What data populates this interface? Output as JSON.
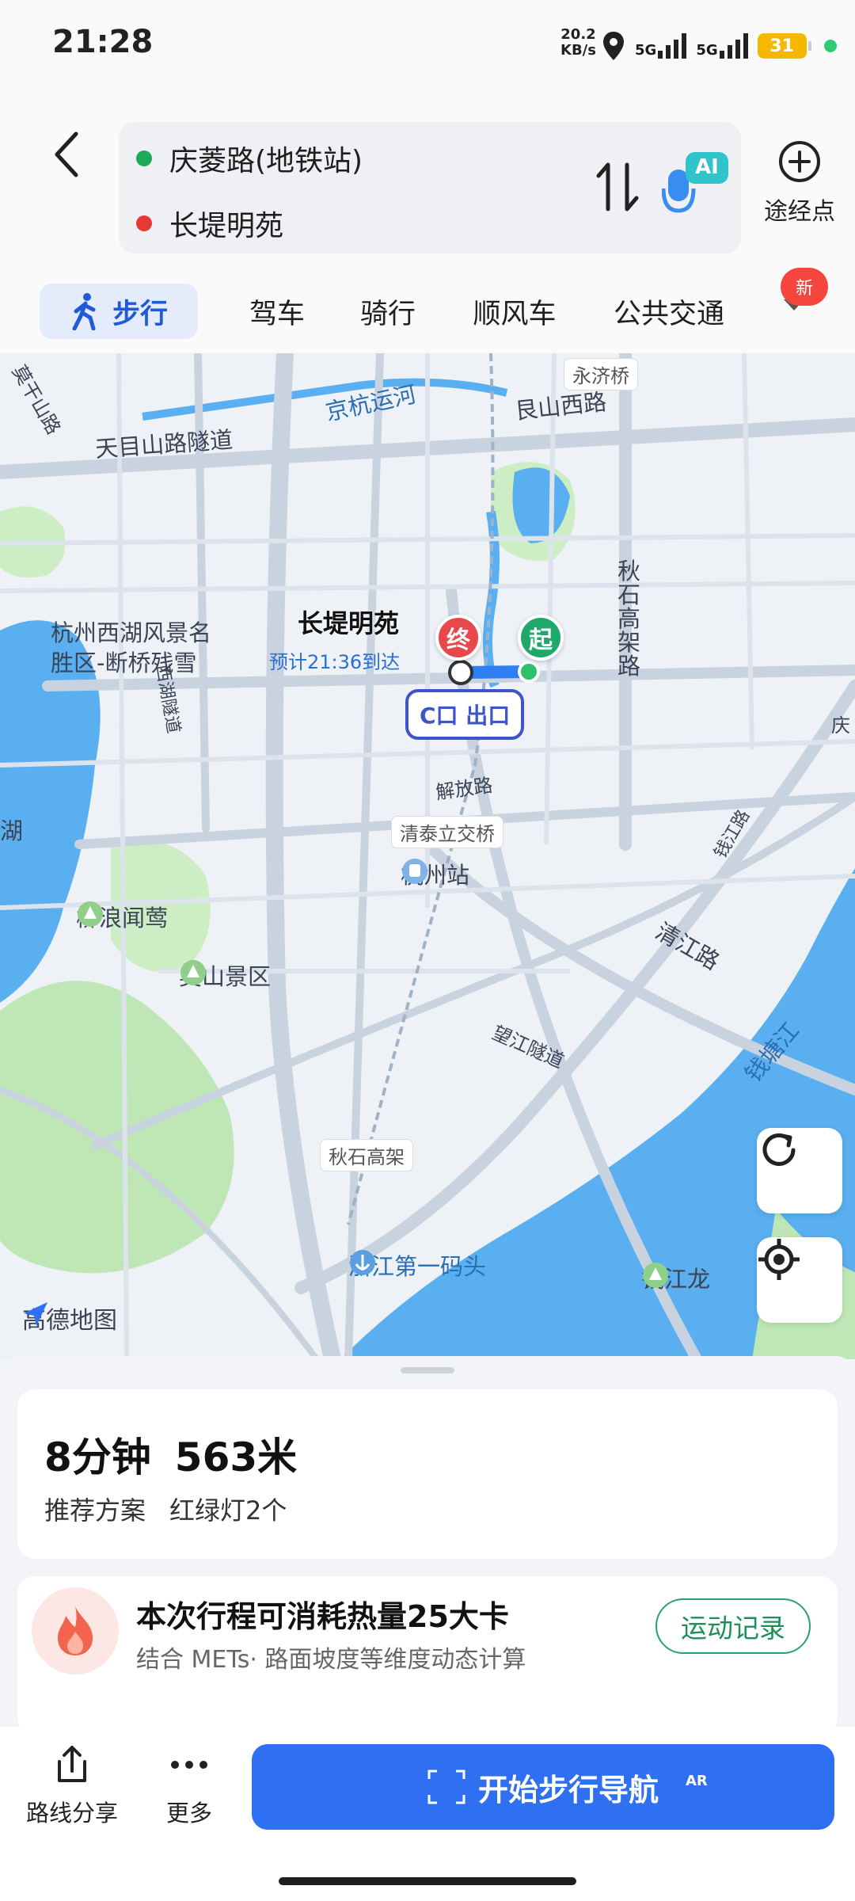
{
  "status_bar": {
    "time": "21:28",
    "net_speed_value": "20.2",
    "net_speed_unit": "KB/s",
    "signal_1": "5G",
    "signal_2": "5G",
    "battery": "31"
  },
  "route": {
    "origin": "庆菱路(地铁站)",
    "destination": "长堤明苑",
    "waypoint_label": "途经点",
    "ai_label": "AI",
    "origin_color": "#1ea85a",
    "destination_color": "#e53935"
  },
  "tabs": [
    {
      "label": "步行",
      "active": true
    },
    {
      "label": "驾车",
      "active": false
    },
    {
      "label": "骑行",
      "active": false
    },
    {
      "label": "顺风车",
      "active": false
    },
    {
      "label": "公共交通",
      "active": false
    }
  ],
  "new_badge": "新",
  "map": {
    "labels": {
      "yongji_bridge": "永济桥",
      "jinghang_canal": "京杭运河",
      "genshan_road": "艮山西路",
      "tianmushan_tunnel": "天目山路隧道",
      "moganshan_road": "莫干山路",
      "qiushi_elevated_v": "秋石高架路",
      "westlake_scenic_1": "杭州西湖风景名",
      "westlake_scenic_2": "胜区-断桥残雪",
      "xibao_tunnel": "西湖隧道",
      "hu": "湖",
      "jiefang_road": "解放路",
      "qingtai_bridge": "清泰立交桥",
      "hangzhou_station": "杭州站",
      "liulang_wenying": "柳浪闻莺",
      "wushan": "吴山景区",
      "qingjiang_road": "清江路",
      "wangjiang_tunnel": "望江隧道",
      "qiantang_river": "钱塘江",
      "qiushi_elevated": "秋石高架",
      "zhejiang_pier": "浙江第一码头",
      "qianjianglong": "钱江龙",
      "qianjiang_road": "钱江路",
      "qing": "庆"
    },
    "end_marker": "终",
    "start_marker": "起",
    "dest_name": "长堤明苑",
    "eta": "预计21:36到达",
    "exit_label": "C口 出口",
    "logo": "高德地图"
  },
  "summary": {
    "duration": "8分钟",
    "distance": "563米",
    "plan": "推荐方案",
    "lights": "红绿灯2个"
  },
  "calories": {
    "title": "本次行程可消耗热量25大卡",
    "subtitle": "结合 METs· 路面坡度等维度动态计算",
    "button": "运动记录"
  },
  "actions": {
    "share": "路线分享",
    "more": "更多",
    "start_nav": "开始步行导航",
    "ar": "AR"
  }
}
